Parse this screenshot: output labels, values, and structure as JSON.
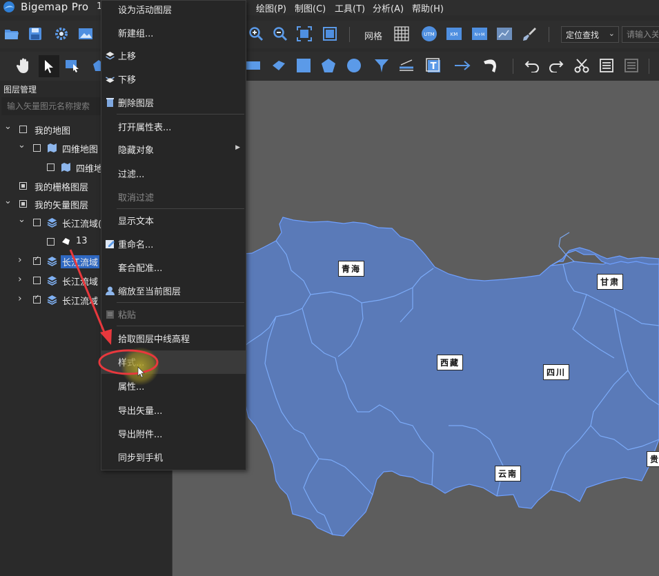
{
  "app": {
    "title": "Bigemap Pro",
    "title_extra": "1"
  },
  "menubar": {
    "items": [
      "绘图(P)",
      "制图(C)",
      "工具(T)",
      "分析(A)",
      "帮助(H)"
    ]
  },
  "toolbar1": {
    "grid_label": "网格",
    "locate_select": "定位查找",
    "address_placeholder": "请输入关",
    "buttons": [
      "open-folder-icon",
      "save-icon",
      "settings-gear-icon",
      "image-icon",
      "zoom-in-icon",
      "zoom-out-icon",
      "full-extent-icon",
      "fit-extent-icon",
      "grid-icon",
      "utm-icon",
      "km-icon",
      "nm-grid-icon",
      "map-icon",
      "brush-icon"
    ],
    "badges": {
      "utm": "UTM",
      "km": "KM",
      "nm": "N+M"
    }
  },
  "toolbar2": {
    "buttons": [
      "pan-hand-icon",
      "select-arrow-icon",
      "select-rect-icon",
      "polygon-pick-icon",
      "rectangle-icon",
      "diamond-icon",
      "square-icon",
      "pentagon-icon",
      "circle-icon",
      "funnel-icon",
      "measure-line-icon",
      "text-icon",
      "arrow-right-icon",
      "curve-icon",
      "undo-icon",
      "redo-icon",
      "scissors-icon",
      "list-icon",
      "list-alt-icon"
    ],
    "text_tool": "T"
  },
  "layer_panel": {
    "title": "图层管理",
    "search_placeholder": "输入矢量图元名称搜索",
    "tree": [
      {
        "label": "我的地图",
        "indent": 0,
        "twist": "down",
        "checked": false,
        "icon": ""
      },
      {
        "label": "四维地图",
        "indent": 1,
        "twist": "down",
        "checked": false,
        "icon": "map-icon"
      },
      {
        "label": "四维地图",
        "indent": 2,
        "twist": "",
        "checked": false,
        "icon": "map-icon"
      },
      {
        "label": "我的栅格图层",
        "indent": 0,
        "twist": "",
        "checked": false,
        "icon": "",
        "square": true
      },
      {
        "label": "我的矢量图层",
        "indent": 0,
        "twist": "down",
        "checked": false,
        "icon": "",
        "square": true
      },
      {
        "label": "长江流域(",
        "indent": 1,
        "twist": "down",
        "checked": false,
        "icon": "layers-icon"
      },
      {
        "label": "13",
        "indent": 2,
        "twist": "",
        "checked": false,
        "icon": "polygon-icon"
      },
      {
        "label": "长江流域",
        "indent": 1,
        "twist": "right",
        "checked": true,
        "icon": "layers-icon",
        "selected": true
      },
      {
        "label": "长江流域",
        "indent": 1,
        "twist": "right",
        "checked": false,
        "icon": "layers-icon"
      },
      {
        "label": "长江流域",
        "indent": 1,
        "twist": "right",
        "checked": true,
        "icon": "layers-icon"
      }
    ]
  },
  "context_menu": {
    "items": [
      {
        "label": "设为活动图层",
        "icon": "",
        "disabled": false
      },
      {
        "label": "新建组...",
        "icon": "",
        "disabled": false
      },
      {
        "label": "上移",
        "icon": "layer-up-icon",
        "disabled": false
      },
      {
        "label": "下移",
        "icon": "layer-down-icon",
        "disabled": false
      },
      {
        "label": "删除图层",
        "icon": "trash-icon",
        "disabled": false
      },
      {
        "label": "打开属性表...",
        "icon": "",
        "disabled": false
      },
      {
        "label": "隐藏对象",
        "icon": "",
        "disabled": false,
        "submenu": true
      },
      {
        "label": "过滤...",
        "icon": "",
        "disabled": false
      },
      {
        "label": "取消过滤",
        "icon": "",
        "disabled": true
      },
      {
        "label": "显示文本",
        "icon": "",
        "disabled": false
      },
      {
        "label": "重命名...",
        "icon": "rename-icon",
        "disabled": false
      },
      {
        "label": "套合配准...",
        "icon": "",
        "disabled": false
      },
      {
        "label": "缩放至当前图层",
        "icon": "user-icon",
        "disabled": false
      },
      {
        "label": "粘贴",
        "icon": "paste-icon",
        "disabled": true
      },
      {
        "label": "拾取图层中线高程",
        "icon": "",
        "disabled": false
      },
      {
        "label": "样式...",
        "icon": "",
        "disabled": false,
        "hover": true
      },
      {
        "label": "属性...",
        "icon": "",
        "disabled": false
      },
      {
        "label": "导出矢量...",
        "icon": "",
        "disabled": false
      },
      {
        "label": "导出附件...",
        "icon": "",
        "disabled": false
      },
      {
        "label": "同步到手机",
        "icon": "",
        "disabled": false
      }
    ]
  },
  "map": {
    "labels": [
      "青海",
      "甘肃",
      "西藏",
      "四川",
      "云南",
      "贵"
    ],
    "fill_color": "#5a7ab8",
    "stroke_color": "#6fa0ff",
    "background_color": "#5d5d5d"
  },
  "annotation": {
    "arrow_color": "#e8383d",
    "circle_color": "#e8383d",
    "cursor_glow": "#a89a2a"
  }
}
